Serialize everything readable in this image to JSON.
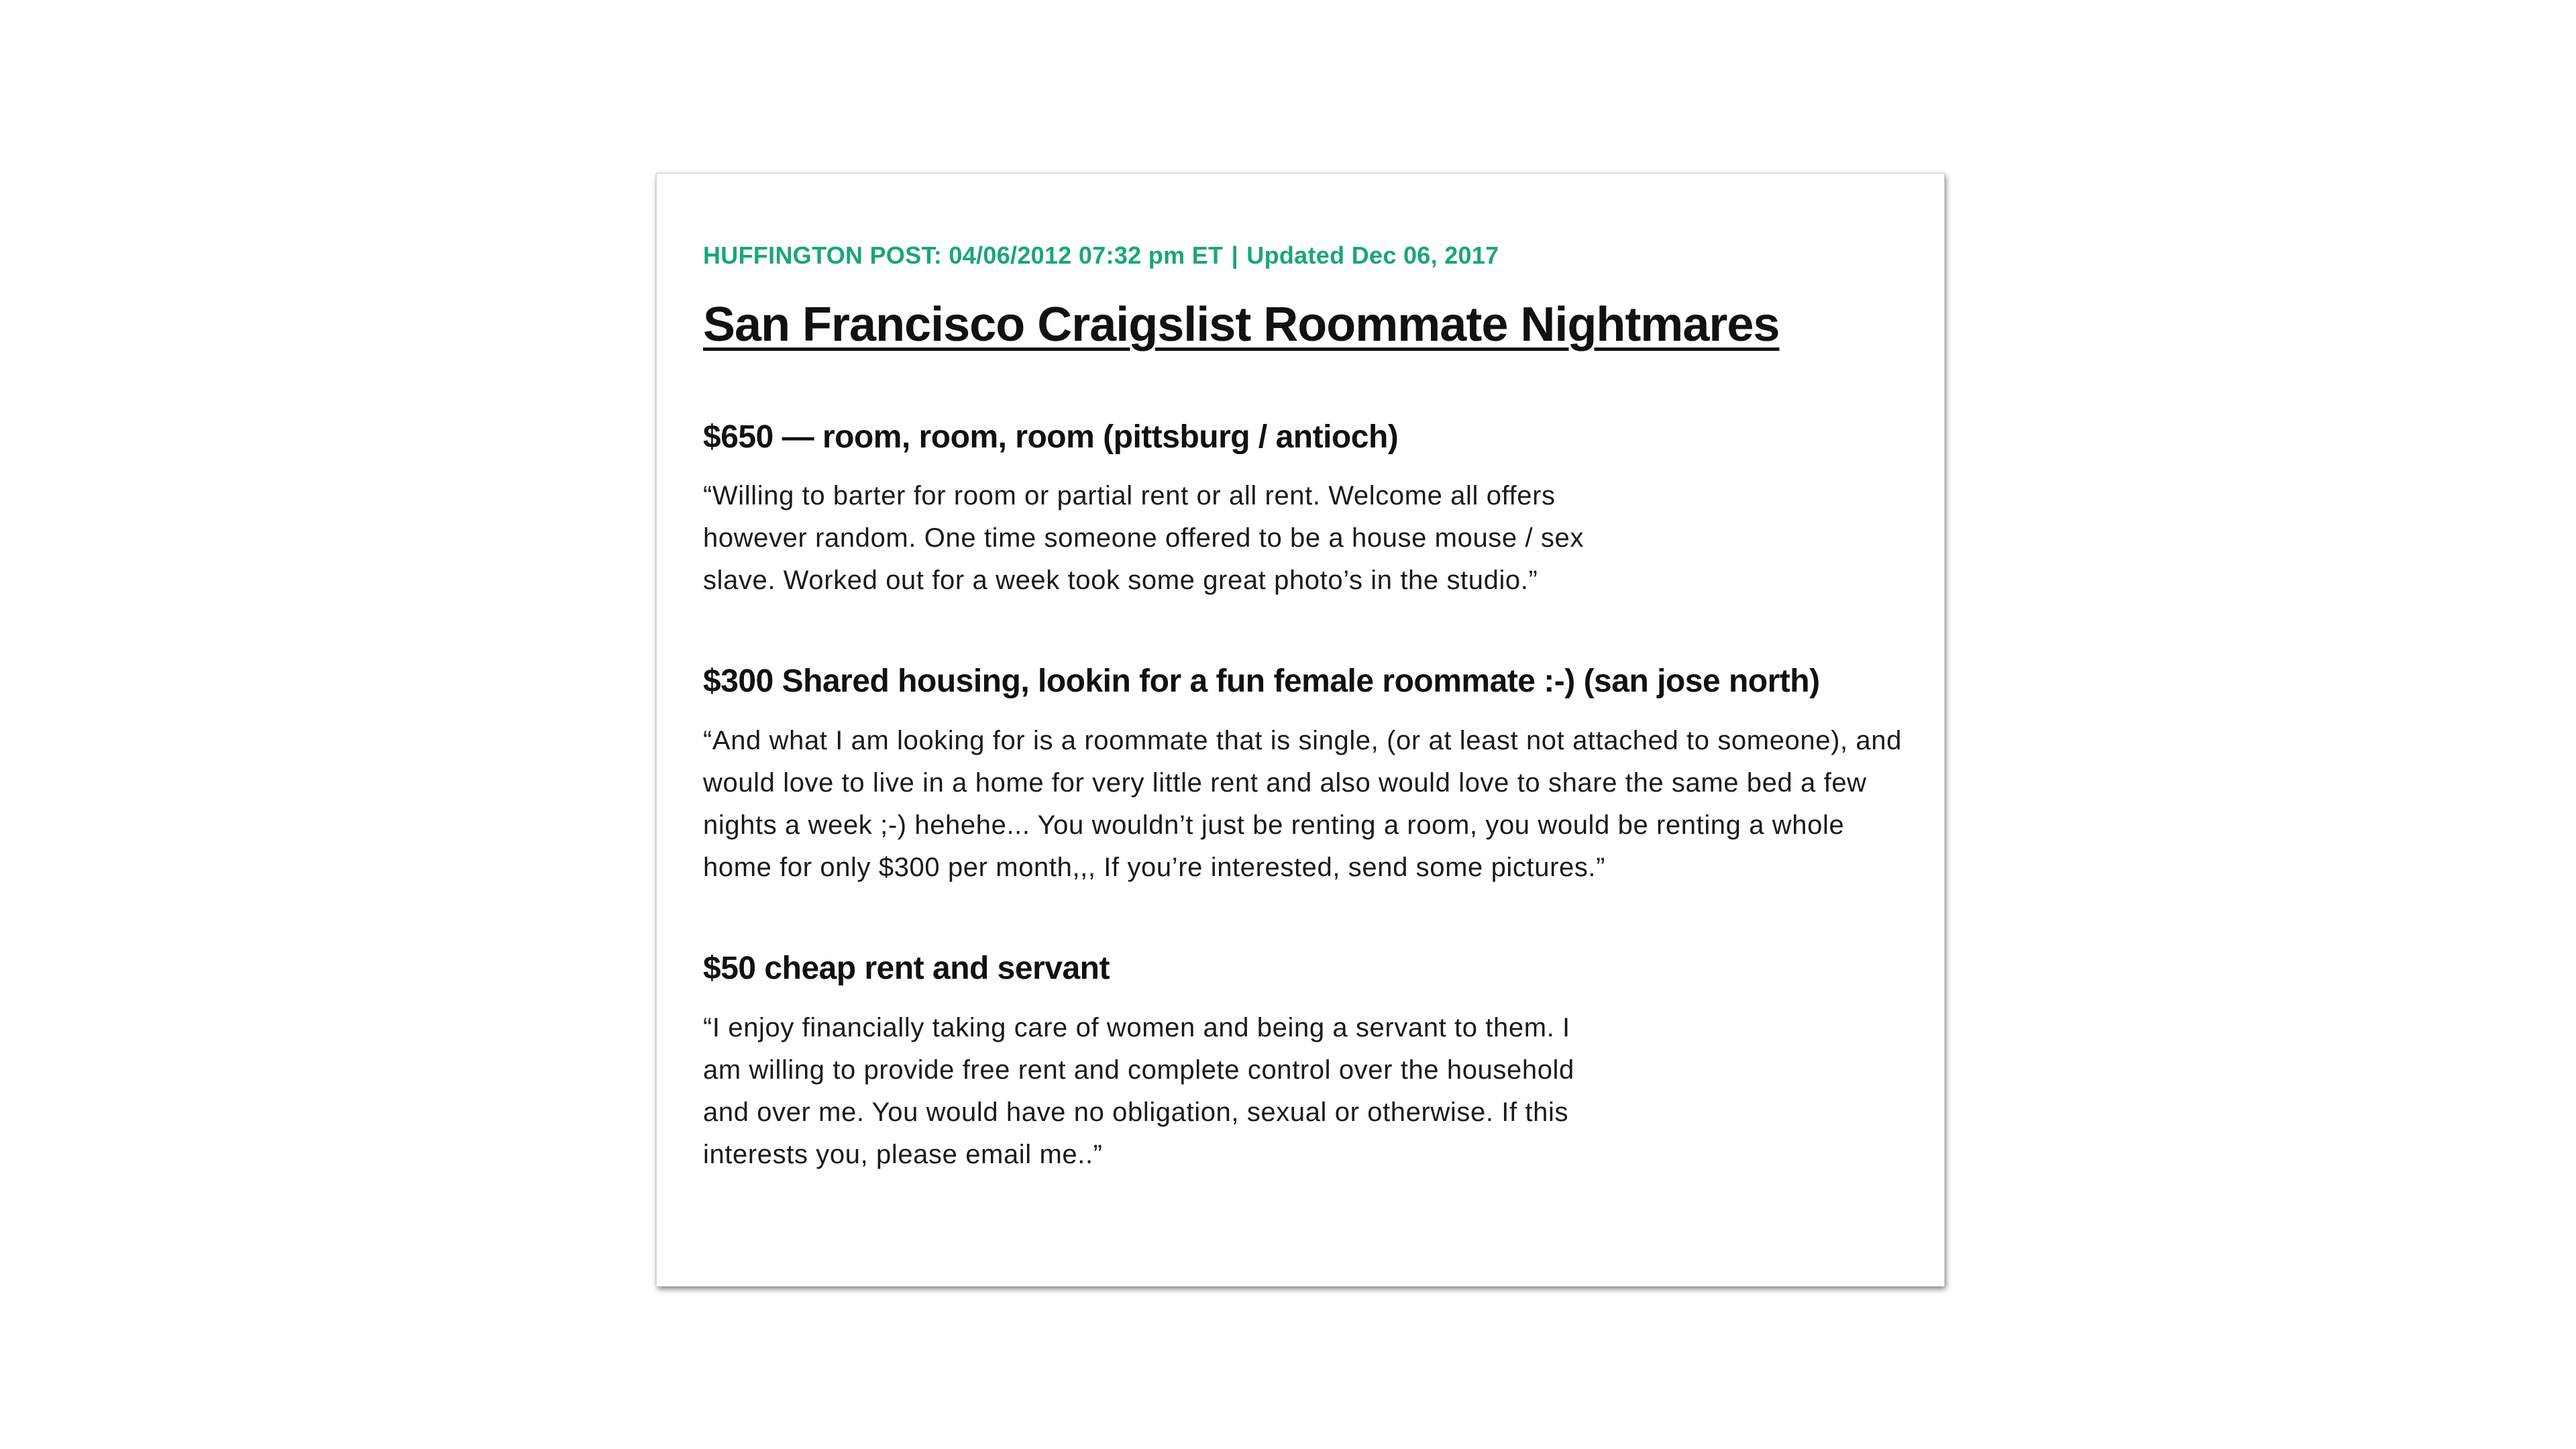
{
  "article": {
    "source": "HUFFINGTON POST: 04/06/2012 07:32 pm ET",
    "separator": "|",
    "updated": "Updated Dec 06, 2017",
    "title": "San Francisco Craigslist Roommate Nightmares"
  },
  "listings": [
    {
      "heading": "$650 — room, room, room (pittsburg / antioch)",
      "quote": "“Willing to barter for room or partial rent or all rent. Welcome all offers however random. One time someone offered to be a house mouse / sex slave. Worked out for a week took some great photo’s in the studio.”"
    },
    {
      "heading": "$300 Shared housing, lookin for a fun female roommate :-) (san jose north)",
      "quote": "“And what I am looking for is a roommate that is single, (or at least not attached to someone), and would love to live in a home for very little rent and also would love to share the same bed a few nights a week ;-) hehehe... You wouldn’t just be renting a room, you would be renting a whole home for only $300 per month,,, If you’re interested, send some pictures.”"
    },
    {
      "heading": "$50 cheap rent and servant",
      "quote": "“I enjoy financially taking care of women and being a servant to them. I am willing to provide free rent and complete control over the household and over me. You would have no obligation, sexual or otherwise. If this interests you, please email me..”"
    }
  ],
  "colors": {
    "meta": "#1aa57b",
    "text": "#111111",
    "background": "#ffffff"
  }
}
